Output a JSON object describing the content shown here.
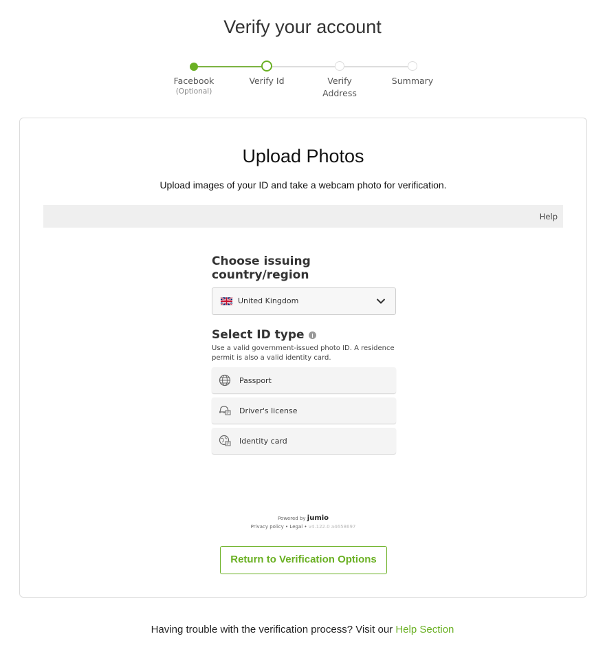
{
  "page": {
    "title": "Verify your account"
  },
  "stepper": {
    "steps": [
      {
        "label": "Facebook",
        "sublabel": "(Optional)",
        "state": "done"
      },
      {
        "label": "Verify Id",
        "state": "active"
      },
      {
        "label": "Verify",
        "label2": "Address",
        "state": "pending"
      },
      {
        "label": "Summary",
        "state": "pending"
      }
    ],
    "colors": {
      "accent": "#6ab023",
      "inactive": "#dddddd"
    }
  },
  "card": {
    "title": "Upload Photos",
    "subtitle": "Upload images of your ID and take a webcam photo for verification.",
    "help_label": "Help"
  },
  "widget": {
    "country_heading": "Choose issuing country/region",
    "country_value": "United Kingdom",
    "flag_icon": "uk-flag-icon",
    "idtype_heading": "Select ID type",
    "idtype_description": "Use a valid government-issued photo ID. A residence permit is also a valid identity card.",
    "options": [
      {
        "label": "Passport",
        "icon": "passport-icon"
      },
      {
        "label": "Driver's license",
        "icon": "drivers-license-icon"
      },
      {
        "label": "Identity card",
        "icon": "identity-card-icon"
      }
    ],
    "powered_prefix": "Powered by",
    "powered_brand": "jumio",
    "privacy": "Privacy policy",
    "legal": "Legal",
    "version": "v4.122.0 a4658697",
    "separator": "•"
  },
  "actions": {
    "return_label": "Return to Verification Options"
  },
  "footer": {
    "text": "Having trouble with the verification process? Visit our",
    "link": "Help Section"
  }
}
